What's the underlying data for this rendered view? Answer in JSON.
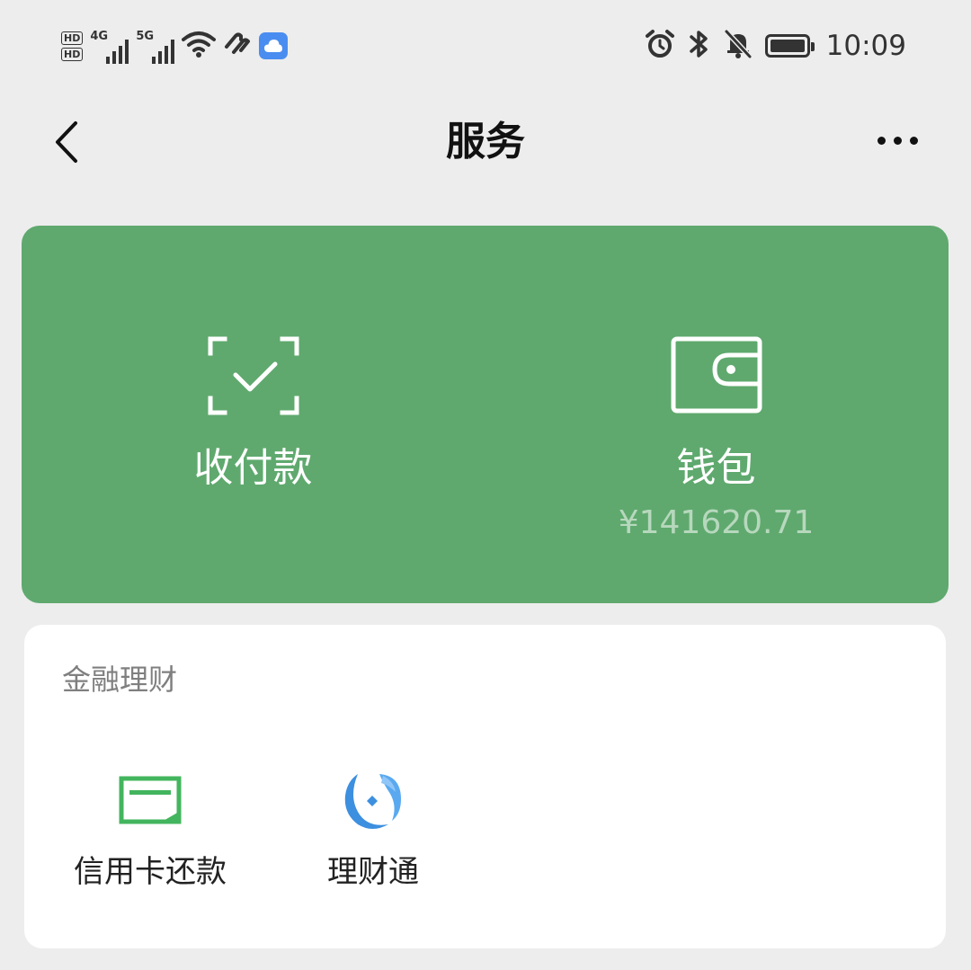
{
  "status_bar": {
    "sim1": "HD",
    "sim2": "HD",
    "net1": "4G",
    "net2": "5G",
    "time": "10:09",
    "icons": [
      "hd-icon",
      "signal-4g-icon",
      "signal-5g-icon",
      "wifi-icon",
      "nfc-icon",
      "cloud-icon",
      "alarm-icon",
      "bluetooth-icon",
      "mute-bell-icon",
      "battery-icon"
    ]
  },
  "nav": {
    "title": "服务",
    "back_icon": "chevron-left-icon",
    "more_icon": "more-dots-icon"
  },
  "top_card": {
    "bg_color": "#5fa96e",
    "pay": {
      "label": "收付款",
      "icon": "scan-check-icon"
    },
    "wallet": {
      "label": "钱包",
      "amount": "¥141620.71",
      "icon": "wallet-icon"
    }
  },
  "finance": {
    "title": "金融理财",
    "items": [
      {
        "label": "信用卡还款",
        "icon": "credit-card-icon",
        "color": "#43b55e"
      },
      {
        "label": "理财通",
        "icon": "licaitong-icon",
        "color": "#4a9be6"
      }
    ]
  }
}
